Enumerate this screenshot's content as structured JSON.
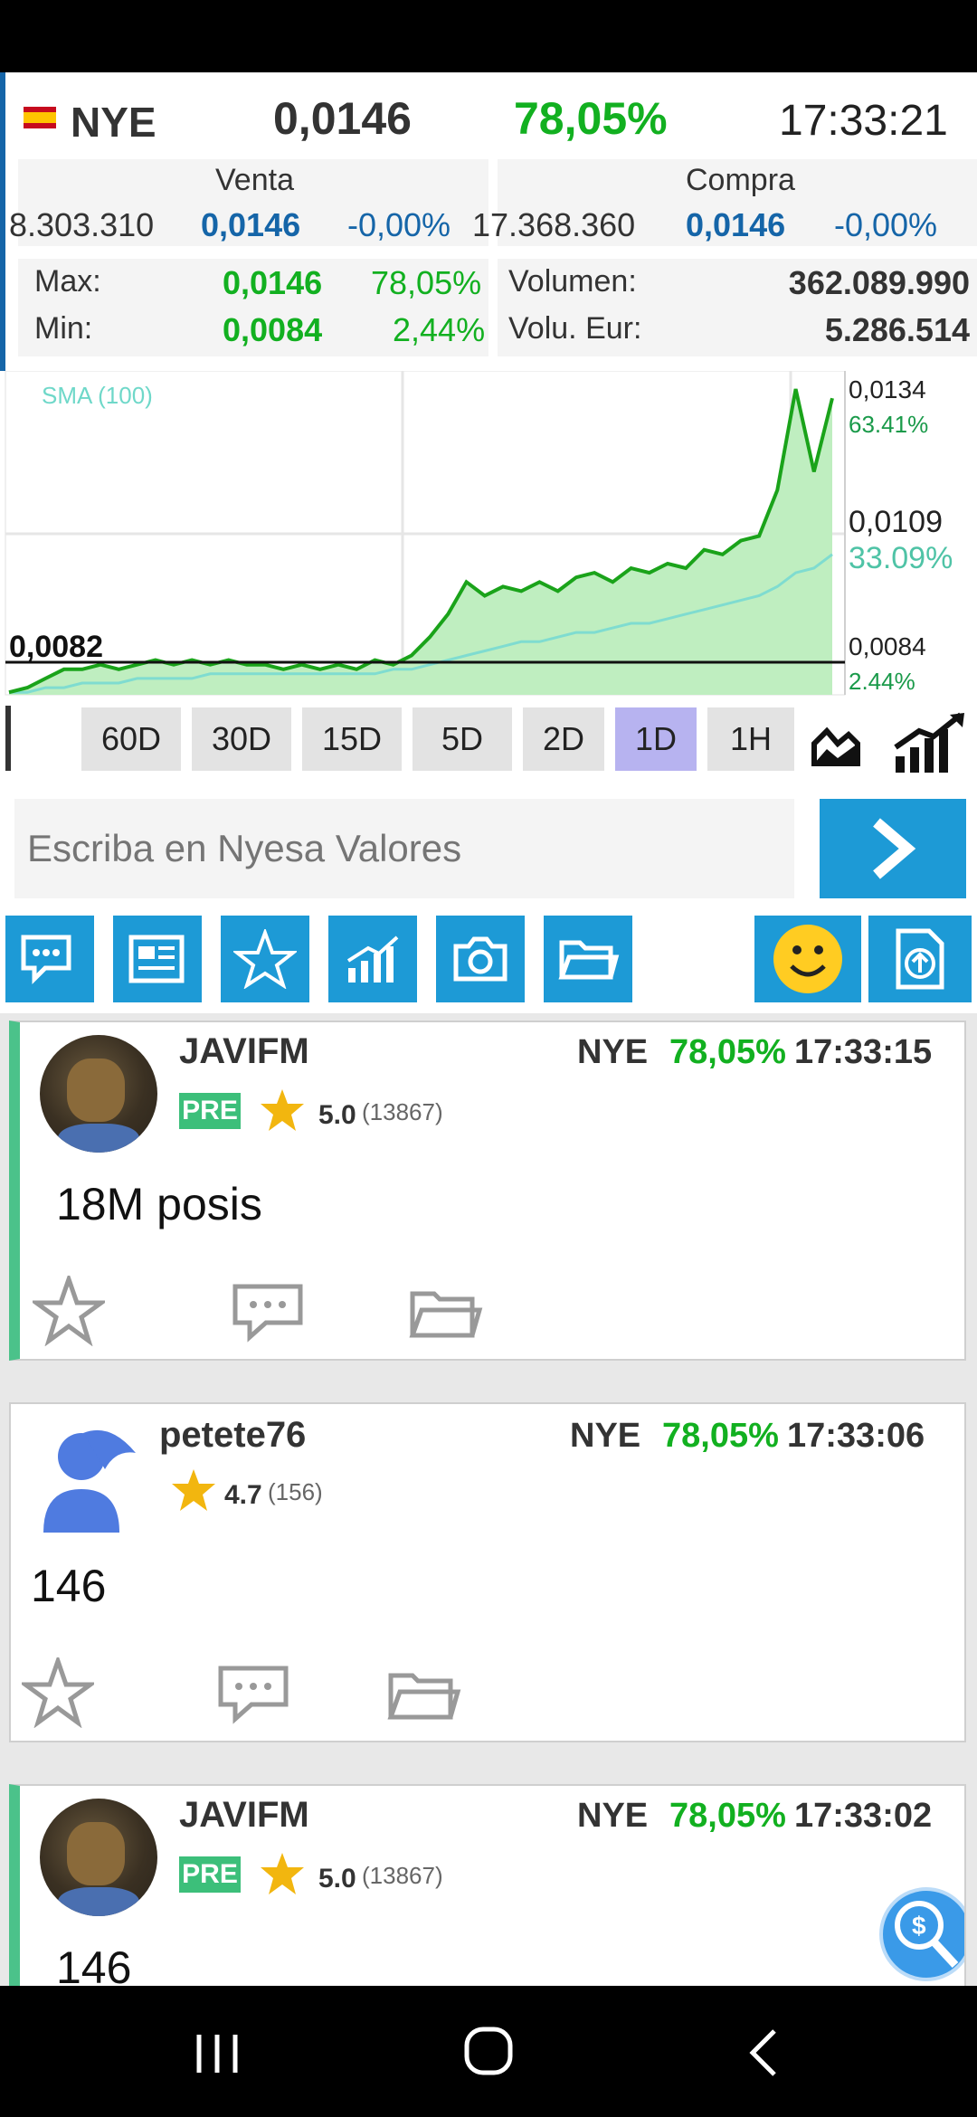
{
  "quote": {
    "flag": "spain-flag",
    "ticker": "NYE",
    "price": "0,0146",
    "change_pct": "78,05%",
    "time": "17:33:21",
    "venta_label": "Venta",
    "compra_label": "Compra",
    "venta_volume": "8.303.310",
    "venta_price": "0,0146",
    "venta_change": "-0,00%",
    "compra_volume": "17.368.360",
    "compra_price": "0,0146",
    "compra_change": "-0,00%",
    "max_label": "Max:",
    "max_value": "0,0146",
    "max_pct": "78,05%",
    "min_label": "Min:",
    "min_value": "0,0084",
    "min_pct": "2,44%",
    "volumen_label": "Volumen:",
    "volumen_value": "362.089.990",
    "volu_eur_label": "Volu. Eur:",
    "volu_eur_value": "5.286.514"
  },
  "chart_data": {
    "type": "area",
    "title": "",
    "legend": "SMA (100)",
    "base_price_label": "0,0082",
    "y_ticks": [
      {
        "value": "0,0134",
        "pct": "63.41%"
      },
      {
        "value": "0,0109",
        "pct": "33.09%"
      },
      {
        "value": "0,0084",
        "pct": "2.44%"
      }
    ],
    "ylim": [
      0.0082,
      0.0146
    ],
    "series": [
      {
        "values": [
          0.008,
          0.0081,
          0.0083,
          0.0085,
          0.0085,
          0.0086,
          0.0085,
          0.0086,
          0.0087,
          0.0086,
          0.0087,
          0.0086,
          0.0087,
          0.0086,
          0.0086,
          0.0085,
          0.0086,
          0.0085,
          0.0086,
          0.0085,
          0.0087,
          0.0086,
          0.0088,
          0.0092,
          0.0097,
          0.0104,
          0.0101,
          0.0103,
          0.0102,
          0.0104,
          0.0102,
          0.0105,
          0.0106,
          0.0104,
          0.0107,
          0.0106,
          0.0108,
          0.0107,
          0.0111,
          0.011,
          0.0113,
          0.0114,
          0.0124,
          0.0146,
          0.0128,
          0.0144
        ]
      },
      {
        "name": "SMA (100)",
        "values": [
          0.008,
          0.008,
          0.0081,
          0.0081,
          0.0082,
          0.0082,
          0.0082,
          0.0083,
          0.0083,
          0.0083,
          0.0083,
          0.0084,
          0.0084,
          0.0084,
          0.0084,
          0.0084,
          0.0084,
          0.0084,
          0.0084,
          0.0084,
          0.0084,
          0.0085,
          0.0085,
          0.0086,
          0.0087,
          0.0088,
          0.0089,
          0.009,
          0.0091,
          0.0091,
          0.0092,
          0.0093,
          0.0093,
          0.0094,
          0.0095,
          0.0095,
          0.0096,
          0.0097,
          0.0098,
          0.0099,
          0.01,
          0.0101,
          0.0103,
          0.0106,
          0.0107,
          0.011
        ]
      }
    ]
  },
  "ranges": {
    "items": [
      "60D",
      "30D",
      "15D",
      "5D",
      "2D",
      "1D",
      "1H"
    ],
    "active": "1D"
  },
  "compose": {
    "placeholder": "Escriba en Nyesa Valores"
  },
  "toolbar_icons": [
    "chat-icon",
    "news-icon",
    "star-icon",
    "chart-icon",
    "camera-icon",
    "folder-icon",
    "smiley-icon",
    "upload-file-icon"
  ],
  "posts": [
    {
      "user": "JAVIFM",
      "ticker": "NYE",
      "pct": "78,05%",
      "time": "17:33:15",
      "badge": "PRE",
      "rating": "5.0",
      "rating_count": "(13867)",
      "text": "18M posis"
    },
    {
      "user": "petete76",
      "ticker": "NYE",
      "pct": "78,05%",
      "time": "17:33:06",
      "rating": "4.7",
      "rating_count": "(156)",
      "text": "146"
    },
    {
      "user": "JAVIFM",
      "ticker": "NYE",
      "pct": "78,05%",
      "time": "17:33:02",
      "badge": "PRE",
      "rating": "5.0",
      "rating_count": "(13867)",
      "text": "146"
    }
  ],
  "colors": {
    "accent": "#1d9ad6",
    "positive": "#12b020",
    "blue_value": "#1565a8",
    "active_range": "#b7b3f0"
  }
}
